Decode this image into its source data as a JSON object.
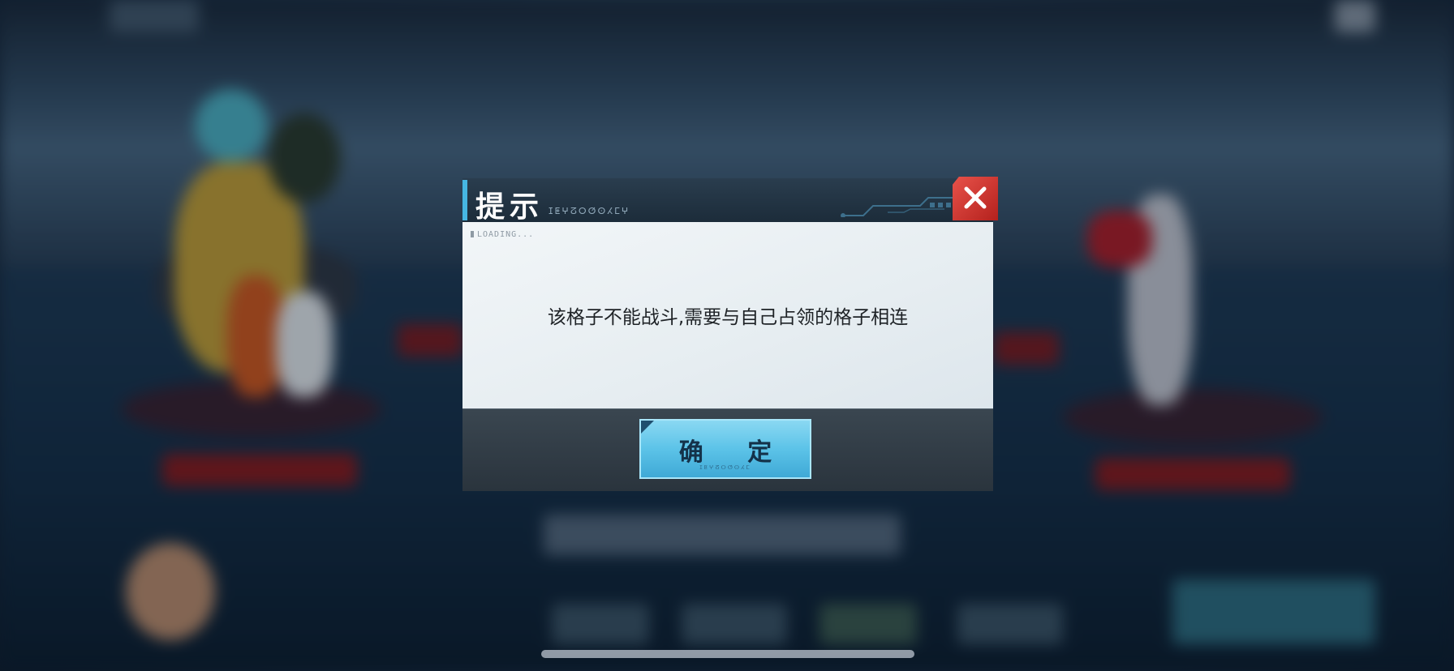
{
  "dialog": {
    "title": "提示",
    "header_code": "ⵊⵟⵖⵒⵔⵚⵙⵃⵎⵖ",
    "loading_label": "LOADING...",
    "message": "该格子不能战斗,需要与自己占领的格子相连",
    "confirm_label": "确 定",
    "confirm_code": "ⵊⵟⵖⵒⵔⵚⵙⵃⵎ",
    "close_icon": "close-icon"
  },
  "colors": {
    "header_accent": "#46b6e2",
    "close_red": "#d63a33",
    "confirm_blue": "#5cc3e8",
    "body_bg": "#eef3f6"
  }
}
